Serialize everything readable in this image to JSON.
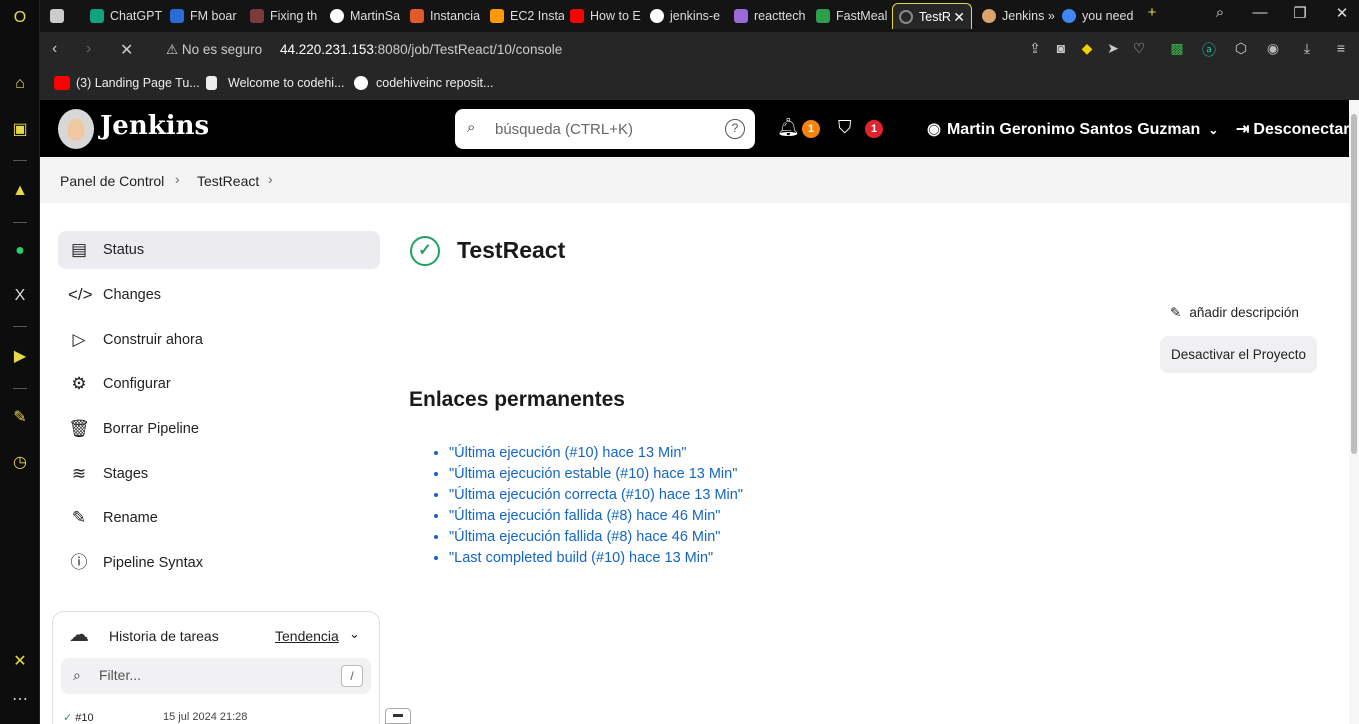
{
  "browser": {
    "tabs": [
      {
        "label": "ChatGPT",
        "color": "#10a37f"
      },
      {
        "label": "FM boar",
        "color": "#2a6bd8"
      },
      {
        "label": "Fixing th",
        "color": "#7a3b3b"
      },
      {
        "label": "MartinSa",
        "color": "#ffffff"
      },
      {
        "label": "Instancia",
        "color": "#e05a2a"
      },
      {
        "label": "EC2 Insta",
        "color": "#ff9900"
      },
      {
        "label": "How to E",
        "color": "#ff0000"
      },
      {
        "label": "jenkins-e",
        "color": "#ffffff"
      },
      {
        "label": "reacttech",
        "color": "#9b6ad8"
      },
      {
        "label": "FastMeal",
        "color": "#2e9e4c"
      },
      {
        "label": "TestR",
        "color": "#888888"
      },
      {
        "label": "Jenkins »",
        "color": "#d9a36a"
      },
      {
        "label": "you need",
        "color": "#4285f4"
      }
    ],
    "insecure_label": "No es seguro",
    "url_host": "44.220.231.153",
    "url_path": ":8080/job/TestReact/10/console",
    "bookmarks": [
      {
        "label": "(3) Landing Page Tu...",
        "color": "#ff0000"
      },
      {
        "label": "Welcome to codehi...",
        "color": "#ffffff"
      },
      {
        "label": "codehiveinc reposit...",
        "color": "#ffffff"
      }
    ]
  },
  "header": {
    "title": "Jenkins",
    "search_placeholder": "búsqueda (CTRL+K)",
    "help": "?",
    "notifications_count": "1",
    "security_count": "1",
    "user_name": "Martin Geronimo Santos Guzman",
    "logout": "Desconectar"
  },
  "breadcrumb": [
    "Panel de Control",
    "TestReact"
  ],
  "sidebar": {
    "items": [
      {
        "label": "Status",
        "icon": "document-icon"
      },
      {
        "label": "Changes",
        "icon": "code-icon"
      },
      {
        "label": "Construir ahora",
        "icon": "play-icon"
      },
      {
        "label": "Configurar",
        "icon": "gear-icon"
      },
      {
        "label": "Borrar Pipeline",
        "icon": "trash-icon"
      },
      {
        "label": "Stages",
        "icon": "layers-icon"
      },
      {
        "label": "Rename",
        "icon": "pencil-icon"
      },
      {
        "label": "Pipeline Syntax",
        "icon": "help-icon"
      }
    ]
  },
  "history": {
    "title": "Historia de tareas",
    "trend": "Tendencia",
    "filter_placeholder": "Filter...",
    "filter_key": "/",
    "first_build": "#10",
    "first_build_date": "15 jul 2024 21:28"
  },
  "main": {
    "title": "TestReact",
    "add_description": "añadir descripción",
    "disable_button": "Desactivar el Proyecto",
    "permalinks_title": "Enlaces permanentes",
    "permalinks": [
      "\"Última ejecución (#10) hace 13 Min\"",
      "\"Última ejecución estable (#10) hace 13 Min\"",
      "\"Última ejecución correcta (#10) hace 13 Min\"",
      "\"Última ejecución fallida (#8) hace 46 Min\"",
      "\"Última ejecución fallida (#8) hace 46 Min\"",
      "\"Last completed build (#10) hace 13 Min\""
    ]
  },
  "colors": {
    "accent": "#e6d84a",
    "badge": "#f5840c",
    "badge_red": "#e0242f",
    "success": "#1ea361",
    "link": "#1466c6"
  }
}
